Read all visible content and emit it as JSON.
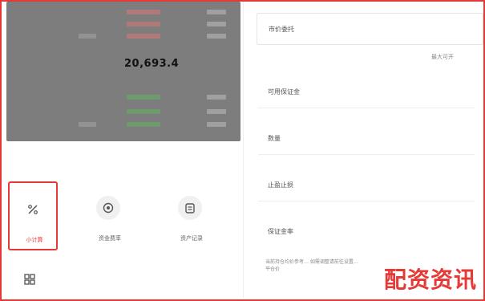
{
  "order_book": {
    "last_price": "20,693.4"
  },
  "form": {
    "order_type_label": "市价委托",
    "hint": "最大可开",
    "fields": [
      {
        "label": "可用保证金"
      },
      {
        "label": "数量"
      },
      {
        "label": "止盈止损"
      },
      {
        "label": "保证金率"
      }
    ],
    "description": "当前持仓均价参考… 如需调整请前往设置… 平仓价"
  },
  "shortcuts": [
    {
      "label": "小计算",
      "icon": "percent-icon"
    },
    {
      "label": "资金费率",
      "icon": "gear-icon"
    },
    {
      "label": "资产记录",
      "icon": "record-icon"
    }
  ],
  "bottom_nav": {
    "icon": "grid-icon"
  },
  "watermark": "配资资讯"
}
